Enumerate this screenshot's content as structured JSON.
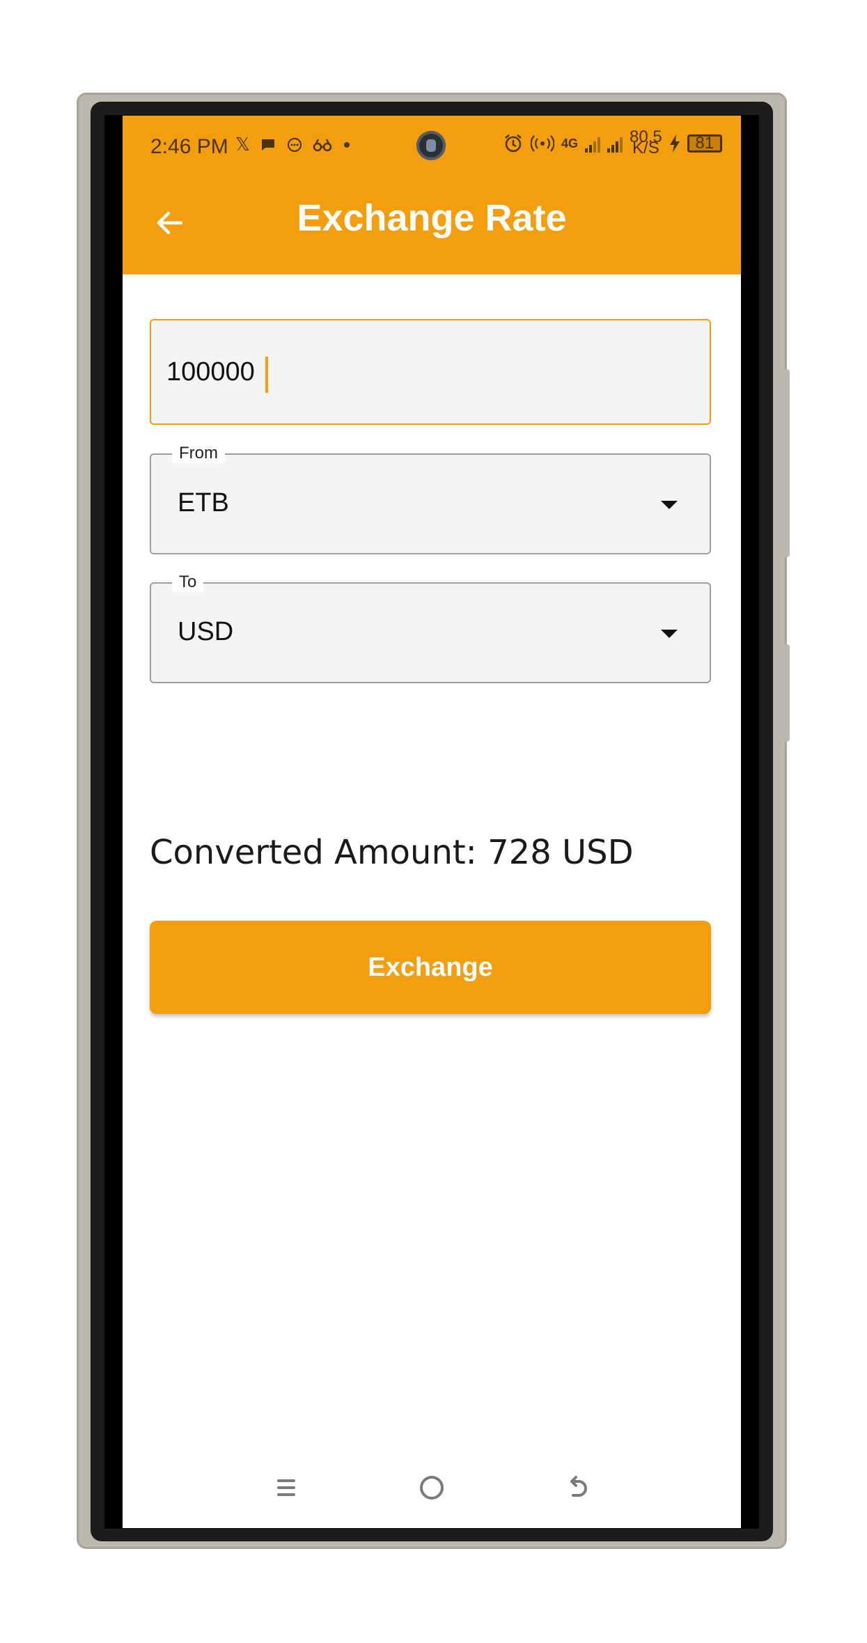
{
  "status_bar": {
    "time": "2:46 PM",
    "network_type": "4G",
    "net_speed_value": "80.5",
    "net_speed_unit": "K/S",
    "battery_level": "81"
  },
  "app_bar": {
    "title": "Exchange Rate"
  },
  "form": {
    "amount_value": "100000",
    "from_label": "From",
    "from_value": "ETB",
    "to_label": "To",
    "to_value": "USD"
  },
  "result": {
    "converted_text": "Converted Amount: 728 USD"
  },
  "actions": {
    "exchange_label": "Exchange"
  },
  "colors": {
    "accent": "#f39e0e",
    "field_background": "#f4f4f4"
  }
}
